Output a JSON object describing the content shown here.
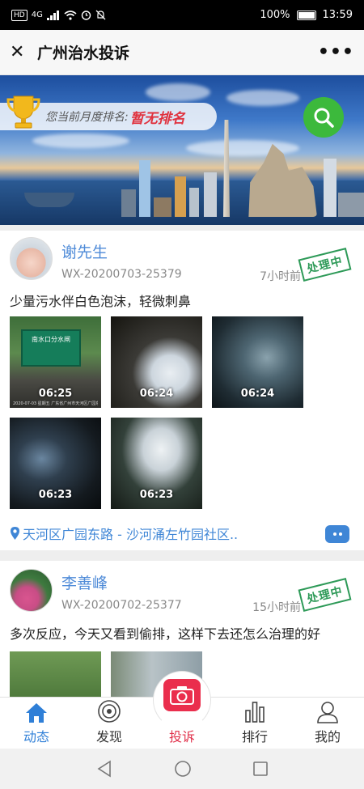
{
  "status_bar": {
    "network": "HD",
    "signal": "4G",
    "battery_percent": "100%",
    "time": "13:59"
  },
  "header": {
    "title": "广州治水投诉",
    "close_icon": "close-icon",
    "more_icon": "more-icon"
  },
  "banner": {
    "rank_label": "您当前月度排名:",
    "rank_value": "暂无排名"
  },
  "posts": [
    {
      "name": "谢先生",
      "id": "WX-20200703-25379",
      "time": "7小时前",
      "status": "处理中",
      "content": "少量污水伴白色泡沫，轻微刺鼻",
      "photo_timestamps": [
        "06:25",
        "06:24",
        "06:24",
        "06:23",
        "06:23"
      ],
      "photo_sign_text": "南水口分水闸",
      "photo_caption": "2020-07-03 星期五 广东省广州市天河区广园东路",
      "location": "天河区广园东路 - 沙河涌左竹园社区.."
    },
    {
      "name": "李善峰",
      "id": "WX-20200702-25377",
      "time": "15小时前",
      "status": "处理中",
      "content": "多次反应，今天又看到偷排，这样下去还怎么治理的好"
    }
  ],
  "tabs": [
    {
      "label": "动态",
      "icon": "home-icon",
      "active": true
    },
    {
      "label": "发现",
      "icon": "discover-icon"
    },
    {
      "label": "投诉",
      "icon": "camera-icon"
    },
    {
      "label": "排行",
      "icon": "ranking-icon"
    },
    {
      "label": "我的",
      "icon": "user-icon"
    }
  ],
  "colors": {
    "accent_blue": "#3f86d6",
    "search_green": "#3cb93c",
    "stamp_green": "#2e9a58",
    "rank_red": "#e0313d",
    "camera_red": "#ea2e4d"
  }
}
